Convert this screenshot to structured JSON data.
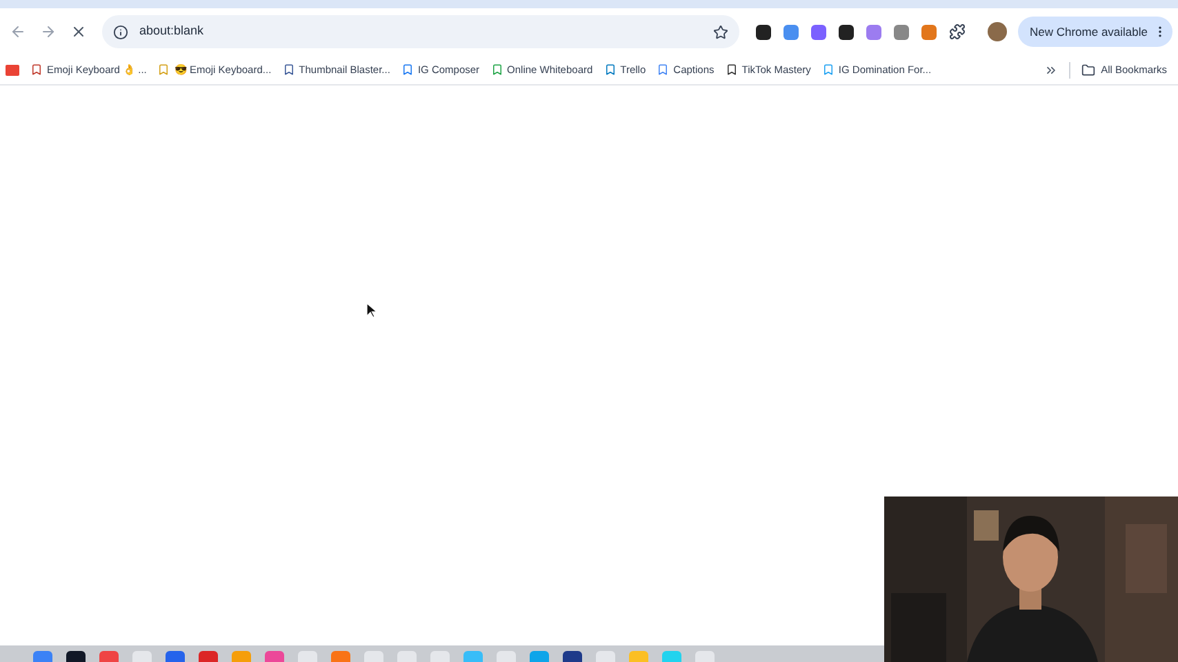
{
  "address_bar": {
    "value": "about:blank",
    "loading": true
  },
  "chrome_update": {
    "label": "New Chrome available"
  },
  "bookmarks": [
    {
      "label": "Emoji Keyboard 👌 ..."
    },
    {
      "label": "😎 Emoji Keyboard..."
    },
    {
      "label": "Thumbnail Blaster..."
    },
    {
      "label": "IG Composer"
    },
    {
      "label": "Online Whiteboard"
    },
    {
      "label": "Trello"
    },
    {
      "label": "Captions"
    },
    {
      "label": "TikTok Mastery"
    },
    {
      "label": "IG Domination For..."
    }
  ],
  "all_bookmarks": {
    "label": "All Bookmarks"
  }
}
